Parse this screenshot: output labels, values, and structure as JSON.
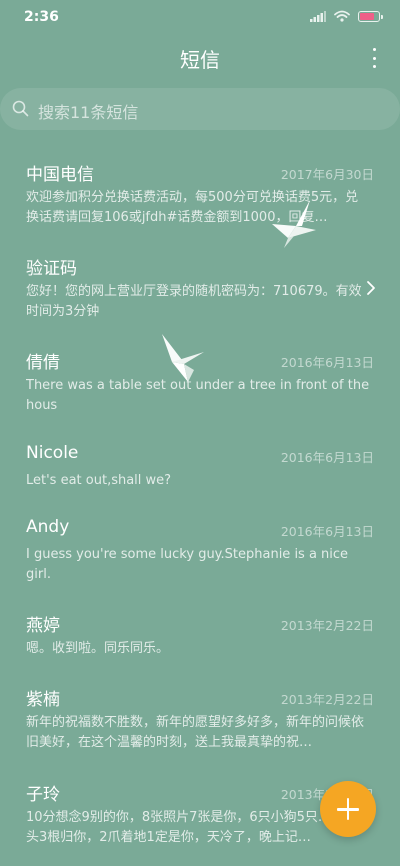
{
  "status_bar": {
    "time": "2:36",
    "battery_color": "#ef5f88",
    "battery_level": 0.8
  },
  "header": {
    "title": "短信",
    "more_icon": "more-vertical-icon"
  },
  "search": {
    "placeholder": "搜索11条短信",
    "icon": "search-icon"
  },
  "messages": [
    {
      "sender": "中国电信",
      "date": "2017年6月30日",
      "preview": "欢迎参加积分兑换话费活动，每500分可兑换话费5元，兑换话费请回复106或jfdh#话费金额到1000，回复…"
    },
    {
      "sender": "验证码",
      "date": "",
      "preview": "您好！您的网上营业厅登录的随机密码为：710679。有效时间为3分钟"
    },
    {
      "sender": "倩倩",
      "date": "2016年6月13日",
      "preview": "There was a table set out under a tree in front of the hous"
    },
    {
      "sender": "Nicole",
      "date": "2016年6月13日",
      "preview": "Let's eat out,shall we?"
    },
    {
      "sender": "Andy",
      "date": "2016年6月13日",
      "preview": "I guess you're some lucky guy.Stephanie is a nice girl."
    },
    {
      "sender": "燕婷",
      "date": "2013年2月22日",
      "preview": "嗯。收到啦。同乐同乐。"
    },
    {
      "sender": "紫楠",
      "date": "2013年2月22日",
      "preview": "新年的祝福数不胜数，新年的愿望好多好多，新年的问候依旧美好，在这个温馨的时刻，送上我最真挚的祝…"
    },
    {
      "sender": "子玲",
      "date": "2013年2月22日",
      "preview": "10分想念9别的你，8张照片7张是你，6只小狗5只…4根骨头3根归你，2爪着地1定是你，天冷了，晚上记…"
    }
  ],
  "fab": {
    "icon": "plus-icon",
    "color": "#f5a623"
  },
  "colors": {
    "background": "#7aaa97",
    "accent": "#f5a623"
  }
}
